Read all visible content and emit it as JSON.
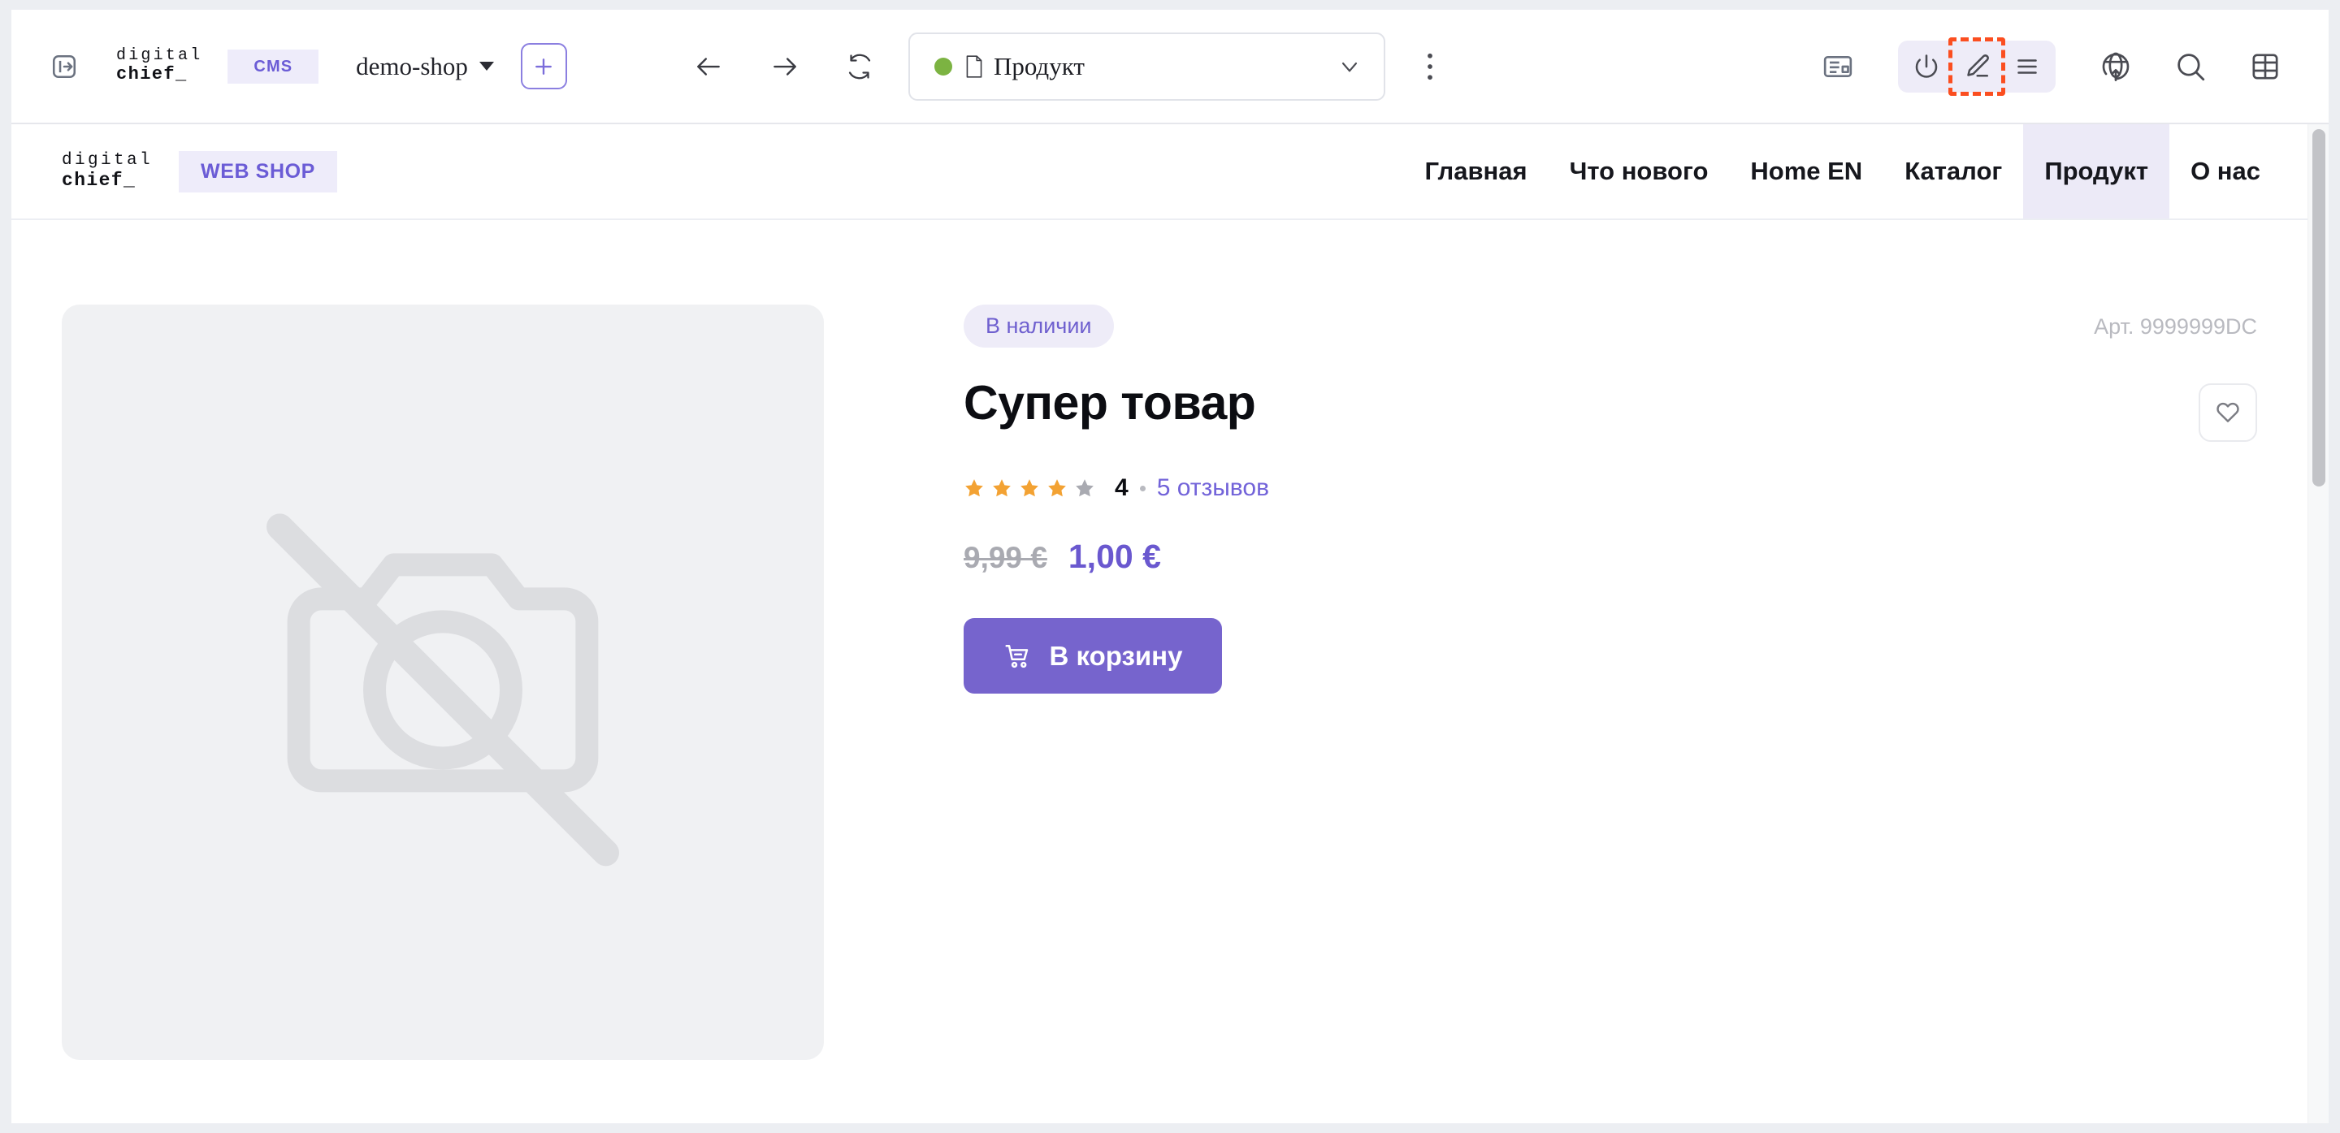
{
  "cms_toolbar": {
    "sidebar_toggle_icon": "sidebar-expand-icon",
    "brand": {
      "line1": "digital",
      "line2": "chief_"
    },
    "cms_chip": "CMS",
    "shop_selector": {
      "value": "demo-shop",
      "caret_icon": "caret-down-icon"
    },
    "add_button_icon": "plus-icon",
    "back_icon": "arrow-left-icon",
    "forward_icon": "arrow-right-icon",
    "reload_icon": "reload-icon",
    "page_pill": {
      "status": "published",
      "status_color": "#7cb342",
      "file_icon": "file-icon",
      "label": "Продукт",
      "chevron_icon": "chevron-down-icon"
    },
    "kebab_icon": "more-vertical-icon",
    "right_icons": [
      {
        "name": "layout-blocks-icon",
        "label": "Blocks"
      },
      {
        "name": "power-icon",
        "label": "Power"
      },
      {
        "name": "pencil-icon",
        "label": "Edit",
        "highlighted": true,
        "highlight_color": "#fb4e20"
      },
      {
        "name": "list-lines-icon",
        "label": "Menu"
      },
      {
        "name": "globe-publish-icon",
        "label": "Publish"
      },
      {
        "name": "search-icon",
        "label": "Search"
      },
      {
        "name": "grid-table-icon",
        "label": "Grid"
      }
    ]
  },
  "site": {
    "logo": {
      "line1": "digital",
      "line2": "chief_"
    },
    "badge": "WEB SHOP",
    "nav": [
      {
        "label": "Главная",
        "active": false
      },
      {
        "label": "Что нового",
        "active": false
      },
      {
        "label": "Home EN",
        "active": false
      },
      {
        "label": "Каталог",
        "active": false
      },
      {
        "label": "Продукт",
        "active": true
      },
      {
        "label": "О нас",
        "active": false
      }
    ]
  },
  "product": {
    "image_placeholder_icon": "no-image-camera-icon",
    "stock_badge": "В наличии",
    "sku": "Арт. 9999999DC",
    "title": "Супер товар",
    "favorite_icon": "heart-icon",
    "rating": {
      "value": "4",
      "stars_filled": 4,
      "stars_total": 5,
      "separator": "·",
      "reviews_label": "5 отзывов"
    },
    "price": {
      "old": "9,99 €",
      "current": "1,00 €"
    },
    "cart_button": {
      "label": "В корзину",
      "icon": "shopping-cart-icon"
    }
  },
  "colors": {
    "accent_purple": "#7664cd",
    "chip_bg": "#eeecfa",
    "chip_text": "#6b5cd6",
    "star_orange": "#f3a233",
    "star_gray": "#a9aab1",
    "highlight_orange": "#fb4e20",
    "status_green": "#7cb342"
  }
}
